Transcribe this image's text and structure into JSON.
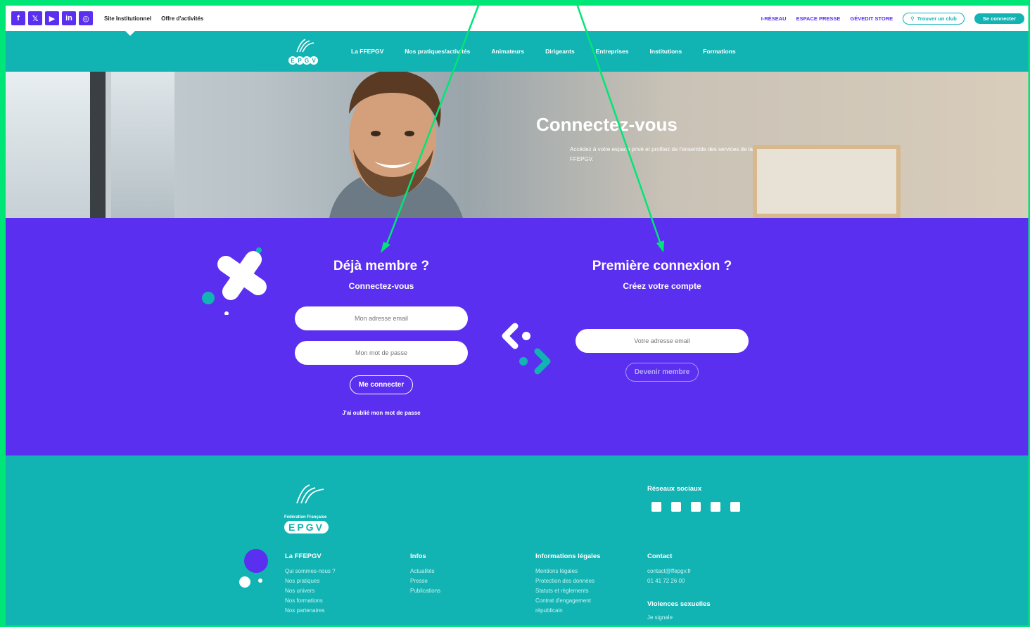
{
  "topbar": {
    "social": [
      "f",
      "𝕏",
      "▶",
      "in",
      "◎"
    ],
    "links": [
      "Site Institutionnel",
      "Offre d'activités"
    ],
    "right_links": [
      "I-RÉSEAU",
      "ESPACE PRESSE",
      "GÉVEDIT STORE"
    ],
    "find_club": "Trouver un club",
    "login": "Se connecter"
  },
  "nav": {
    "logo_text": "EPGV",
    "items": [
      "La FFEPGV",
      "Nos pratiques/activités",
      "Animateurs",
      "Dirigeants",
      "Entreprises",
      "Institutions",
      "Formations"
    ]
  },
  "hero": {
    "title": "Connectez-vous",
    "subtitle": "Accédez à votre espace privé et profitez de l'ensemble des services de la FFEPGV."
  },
  "login": {
    "member_title": "Déjà membre ?",
    "member_sub": "Connectez-vous",
    "email_placeholder": "Mon adresse email",
    "password_placeholder": "Mon mot de passe",
    "submit": "Me connecter",
    "forgot": "J'ai oublié mon mot de passe",
    "new_title": "Première connexion ?",
    "new_sub": "Créez votre compte",
    "new_email_placeholder": "Votre adresse email",
    "new_submit": "Devenir membre"
  },
  "footer": {
    "logo_caption": "Fédération Française",
    "logo_text": "EPGV",
    "social_title": "Réseaux sociaux",
    "col1": {
      "title": "La FFEPGV",
      "items": [
        "Qui sommes-nous ?",
        "Nos pratiques",
        "Nos univers",
        "Nos formations",
        "Nos partenaires"
      ]
    },
    "col2": {
      "title": "Infos",
      "items": [
        "Actualités",
        "Presse",
        "Publications"
      ]
    },
    "col3": {
      "title": "Informations légales",
      "items": [
        "Mentions légales",
        "Protection des données",
        "Statuts et règlements",
        "Contrat d'engagement",
        "républicain"
      ]
    },
    "col4": {
      "title": "Contact",
      "items": [
        "contact@ffepgv.fr",
        "01 41 72 26 00"
      ]
    },
    "col5": {
      "title": "Violences sexuelles",
      "items": [
        "Je signale"
      ]
    }
  },
  "colors": {
    "teal": "#12b3b3",
    "purple": "#5b2ff0",
    "annotation": "#00e676"
  }
}
